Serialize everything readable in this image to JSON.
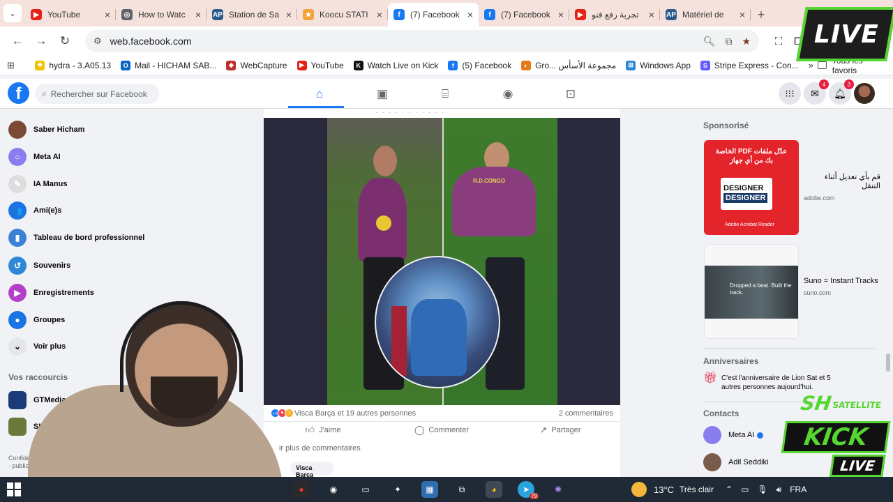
{
  "browser": {
    "tabs": [
      {
        "title": "YouTube",
        "color": "#e62117",
        "glyph": "▶"
      },
      {
        "title": "How to Watc",
        "color": "#5f6368",
        "glyph": "◎"
      },
      {
        "title": "Station de Sa",
        "color": "#2a5a8c",
        "glyph": "AP"
      },
      {
        "title": "Koocu STATI",
        "color": "#f2a33a",
        "glyph": "★"
      },
      {
        "title": "(7) Facebook",
        "color": "#1877f2",
        "glyph": "f",
        "active": true
      },
      {
        "title": "(7) Facebook",
        "color": "#1877f2",
        "glyph": "f"
      },
      {
        "title": "تجربة رفع قنو",
        "color": "#e62117",
        "glyph": "▶"
      },
      {
        "title": "Matériel de",
        "color": "#2a5a8c",
        "glyph": "AP"
      }
    ],
    "url": "web.facebook.com",
    "bookmarks": [
      {
        "label": "hydra - 3.A05.13",
        "color": "#f2c200",
        "glyph": "❖"
      },
      {
        "label": "Mail - HICHAM SAB...",
        "color": "#0a64c8",
        "glyph": "O"
      },
      {
        "label": "WebCapture",
        "color": "#c22d2d",
        "glyph": "◆"
      },
      {
        "label": "YouTube",
        "color": "#e62117",
        "glyph": "▶"
      },
      {
        "label": "Watch Live on Kick",
        "color": "#111111",
        "glyph": "K"
      },
      {
        "label": "(5) Facebook",
        "color": "#1877f2",
        "glyph": "f"
      },
      {
        "label": "Gro... مجموعة الأسأس",
        "color": "#e57a1a",
        "glyph": "◐"
      },
      {
        "label": "Windows App",
        "color": "#2b88d8",
        "glyph": "⊞"
      },
      {
        "label": "Stripe Express - Con...",
        "color": "#635bff",
        "glyph": "S"
      }
    ],
    "bookmarks_more": "»",
    "all_bookmarks": "Tous les favoris"
  },
  "facebook": {
    "logo": "f",
    "search_placeholder": "Rechercher sur Facebook",
    "messenger_badge": "4",
    "notifications_badge": "3",
    "sidebar": {
      "items": [
        {
          "label": "Saber Hicham",
          "color": "#7a4a35",
          "glyph": ""
        },
        {
          "label": "Meta AI",
          "color": "#8a7df0",
          "glyph": "○"
        },
        {
          "label": "IA Manus",
          "color": "#dddddd",
          "glyph": "✎"
        },
        {
          "label": "Ami(e)s",
          "color": "#1b74e4",
          "glyph": "👥"
        },
        {
          "label": "Tableau de bord professionnel",
          "color": "#3b82d6",
          "glyph": "▮"
        },
        {
          "label": "Souvenirs",
          "color": "#2d88d8",
          "glyph": "↺"
        },
        {
          "label": "Enregistrements",
          "color": "#b43fc8",
          "glyph": "▶"
        },
        {
          "label": "Groupes",
          "color": "#1b74e4",
          "glyph": "●"
        },
        {
          "label": "Voir plus",
          "color": "#e4e6eb",
          "glyph": "⌄"
        }
      ],
      "shortcuts_title": "Vos raccourcis",
      "shortcuts": [
        {
          "label": "GTMedia Arab & Euro",
          "color": "#1a3a7a"
        },
        {
          "label": "SH live",
          "color": "#6a7a3a"
        }
      ],
      "footer": "Confidentialité · publicitaire"
    },
    "post": {
      "reactions_text": "Visca Barça et 19 autres personnes",
      "comments_count": "2 commentaires",
      "like_label": "J'aime",
      "comment_label": "Commenter",
      "share_label": "Partager",
      "more_comments": "ir plus de commentaires",
      "commenter": "Visca Barça",
      "shirt_text": "R.D.CONGO"
    },
    "right": {
      "sponsored_title": "Sponsorisé",
      "ads": [
        {
          "text": "قم بأي تعديل أثناء التنقل",
          "domain": "adobe.com",
          "image_title": "عدّل ملفات PDF الخاصة بك من أي جهاز",
          "image_word1": "DESIGNER",
          "image_word2": "DESIGNER",
          "image_brand": "Adobe Acrobat Reader"
        },
        {
          "text": "Suno = Instant Tracks",
          "domain": "suno.com",
          "image_caption": "Dropped a beat. Built the track."
        }
      ],
      "birthdays_title": "Anniversaires",
      "birthday_text": "C'est l'anniversaire de Lion Sat et 5 autres personnes aujourd'hui.",
      "contacts_title": "Contacts",
      "contacts": [
        {
          "name": "Meta AI",
          "verified": true,
          "color": "#8a7df0"
        },
        {
          "name": "Adil Seddiki",
          "verified": false,
          "color": "#7a5a4a"
        }
      ]
    }
  },
  "taskbar": {
    "temperature": "13°C",
    "weather_desc": "Très clair",
    "language": "FRA",
    "telegram_badge": "79"
  },
  "overlay": {
    "live_label": "LIVE",
    "kick_sh": "SH",
    "kick_satellite": "SATELLITE",
    "kick_word": "KICK",
    "kick_live": "LIVE"
  }
}
